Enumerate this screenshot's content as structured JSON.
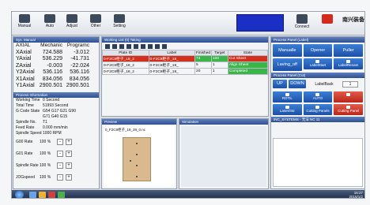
{
  "toolbar": {
    "manual": "Manual",
    "auto": "Auto",
    "adjust": "Adjust",
    "other": "Other",
    "setting": "Setting",
    "connect": "Connect",
    "brand": "南兴装备"
  },
  "coords": {
    "title": "Sys. Manual",
    "header": [
      "AXIAL",
      "Mechanic",
      "Programc"
    ],
    "rows": [
      {
        "axis": "XAxial",
        "mech": "724.588",
        "prog": "-3.012"
      },
      {
        "axis": "YAxial",
        "mech": "536.229",
        "prog": "-41.731"
      },
      {
        "axis": "ZAxial",
        "mech": "-0.003",
        "prog": "-22.024"
      },
      {
        "axis": "Y2Axial",
        "mech": "536.116",
        "prog": "536.116"
      },
      {
        "axis": "X1Axial",
        "mech": "834.056",
        "prog": "834.056"
      },
      {
        "axis": "Y1Axial",
        "mech": "2900.501",
        "prog": "2900.501"
      }
    ]
  },
  "process": {
    "title": "Process Information",
    "rows": [
      {
        "k": "Working Time",
        "v": "0 Second"
      },
      {
        "k": "Total Time",
        "v": "51993 Second"
      },
      {
        "k": "G Code State",
        "v": "G54 G17 G21 G90"
      },
      {
        "k": "",
        "v": "G71 G40 G15"
      },
      {
        "k": "Spindle No.",
        "v": "T1"
      },
      {
        "k": "Feed Rate",
        "v": "0.000 mm/min"
      },
      {
        "k": "Spindle Speed",
        "v": "1000 RPM"
      }
    ],
    "rates": [
      {
        "k": "G00 Rate",
        "v": "100 %"
      },
      {
        "k": "G01 Rate",
        "v": "100 %"
      },
      {
        "k": "Spindle Rate",
        "v": "100 %"
      },
      {
        "k": "JOGspeed",
        "v": "100 %"
      }
    ]
  },
  "tasks": {
    "title": "Working List (0) Taking",
    "columns": [
      "Plate ID",
      "Label",
      "Finished",
      "Target",
      "State"
    ],
    "rows": [
      {
        "id": "0-F2C8柜子_18_2",
        "label": "0-F2C8柜子_18_",
        "fin": "74",
        "target": "100",
        "state": "Cut Sheet"
      },
      {
        "id": "0-F2C8柜子_18_2",
        "label": "0-F2C8柜子_18_",
        "fin": "5",
        "target": "1",
        "state": "Align Sheet"
      },
      {
        "id": "0-F2C8柜子_18_2",
        "label": "0-F2C8柜子_18_",
        "fin": "20",
        "target": "1",
        "state": "Completed"
      }
    ]
  },
  "preview": {
    "title": "Preview",
    "file": "0_F2C8柜子_18_28_0.nc",
    "sim_title": "Simulation"
  },
  "right": {
    "title": "Process Panel (Label)",
    "btn_row1": [
      "Manualle",
      "Opener",
      "Puller"
    ],
    "btn_row2": [
      "Laving_off",
      "LabelStart",
      "LabelRenam"
    ],
    "panel2_title": "Process Panel (Cut)",
    "row3": [
      "UP",
      "DOWN",
      "LabelBack",
      "1"
    ],
    "row4": [
      "ROTIL",
      "AUTO"
    ],
    "row5": [
      "Laser/Intr",
      "Cutting Panels",
      "Cutting Panel"
    ],
    "info_title": "INC_SYSTEMS - 无法 NC 11"
  },
  "taskbar": {
    "time": "15:27",
    "date": "2016/1/2"
  }
}
